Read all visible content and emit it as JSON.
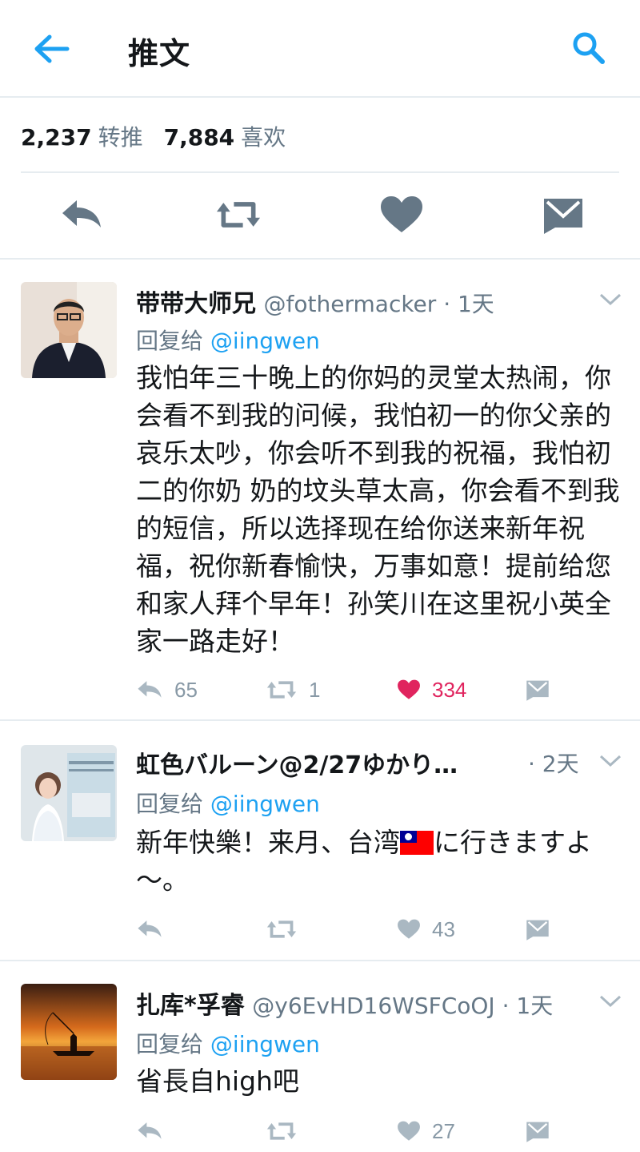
{
  "header": {
    "title": "推文"
  },
  "stats": {
    "retweets": "2,237",
    "retweets_label": "转推",
    "likes": "7,884",
    "likes_label": "喜欢"
  },
  "replies": [
    {
      "name": "带带大师兄",
      "handle": "@fothermacker · 1天",
      "reply_prefix": "回复给",
      "reply_target": "@iingwen",
      "text": "我怕年三十晚上的你妈的灵堂太热闹，你会看不到我的问候，我怕初一的你父亲的哀乐太吵，你会听不到我的祝福，我怕初二的你奶 奶的坟头草太高，你会看不到我的短信，所以选择现在给你送来新年祝福，祝你新春愉快，万事如意！提前给您和家人拜个早年！孙笑川在这里祝小英全家一路走好！",
      "reply_count": "65",
      "retweet_count": "1",
      "like_count": "334",
      "liked": true
    },
    {
      "name": "虹色バルーン@2/27ゆかり…",
      "handle": "· 2天",
      "reply_prefix": "回复给",
      "reply_target": "@iingwen",
      "text_before_flag": "新年快樂！来月、台湾",
      "text_after_flag": "に行きますよ～。",
      "like_count": "43"
    },
    {
      "name": "扎库*孚睿",
      "handle": "@y6EvHD16WSFCoOJ · 1天",
      "reply_prefix": "回复给",
      "reply_target": "@iingwen",
      "text": "省長自high吧",
      "like_count": "27"
    }
  ],
  "colors": {
    "accent": "#1da1f2",
    "like": "#e0245e",
    "icon": "#657786",
    "icon_light": "#aab8c2"
  }
}
